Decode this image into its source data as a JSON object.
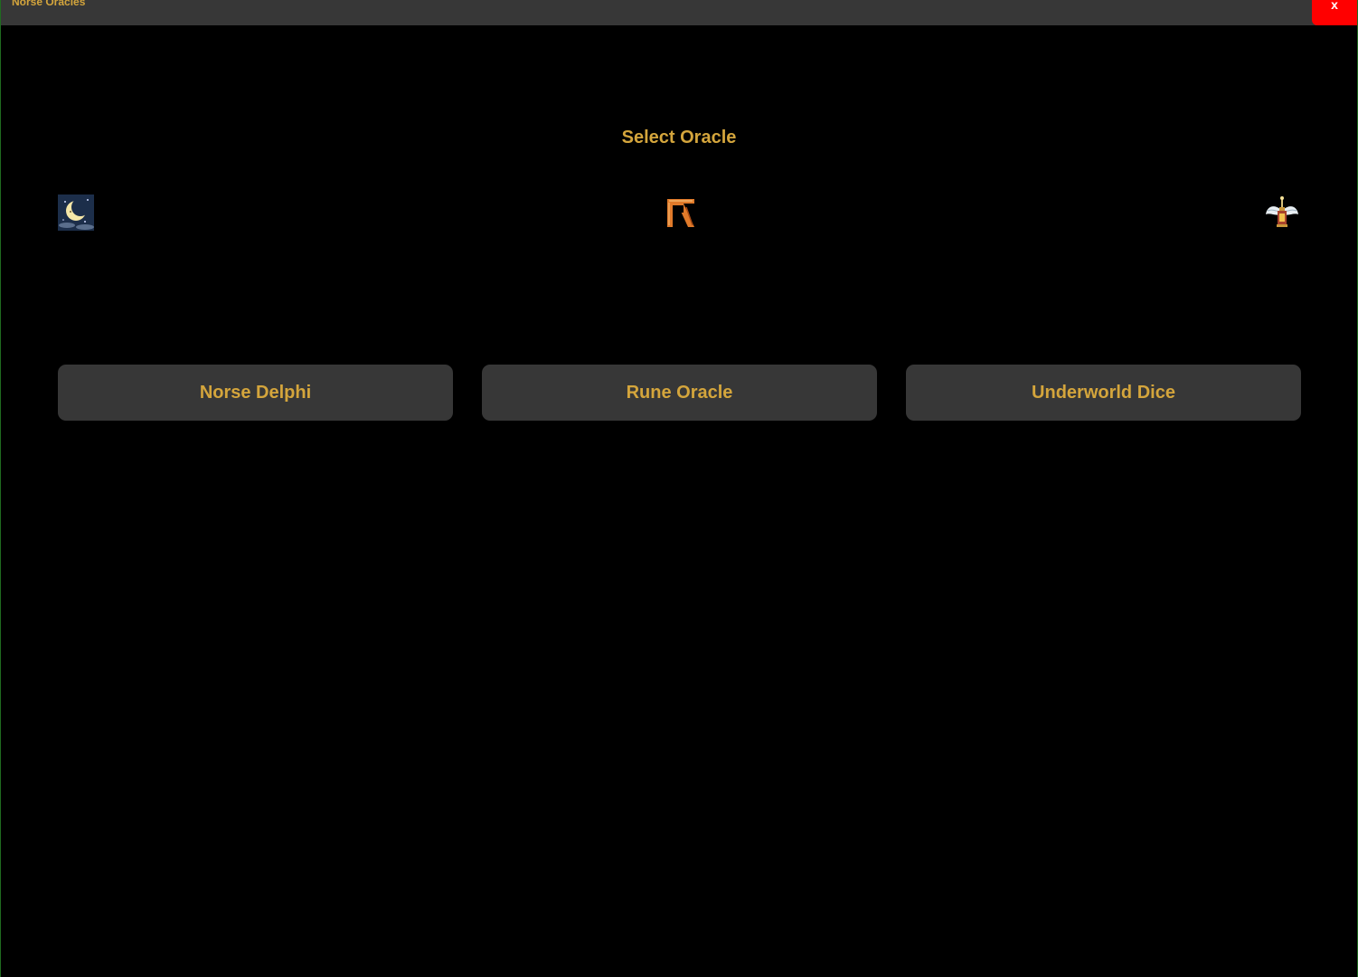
{
  "window": {
    "title": "Norse Oracles",
    "close_label": "x"
  },
  "main": {
    "heading": "Select Oracle",
    "icons": [
      "crescent-moon-icon",
      "rune-icon",
      "winged-lantern-icon"
    ],
    "buttons": [
      {
        "label": "Norse Delphi"
      },
      {
        "label": "Rune Oracle"
      },
      {
        "label": "Underworld Dice"
      }
    ]
  },
  "colors": {
    "background": "#000000",
    "title_bar": "#373737",
    "accent_text": "#d4a53c",
    "button_bg": "#373737",
    "close_bg": "#ff0000"
  }
}
